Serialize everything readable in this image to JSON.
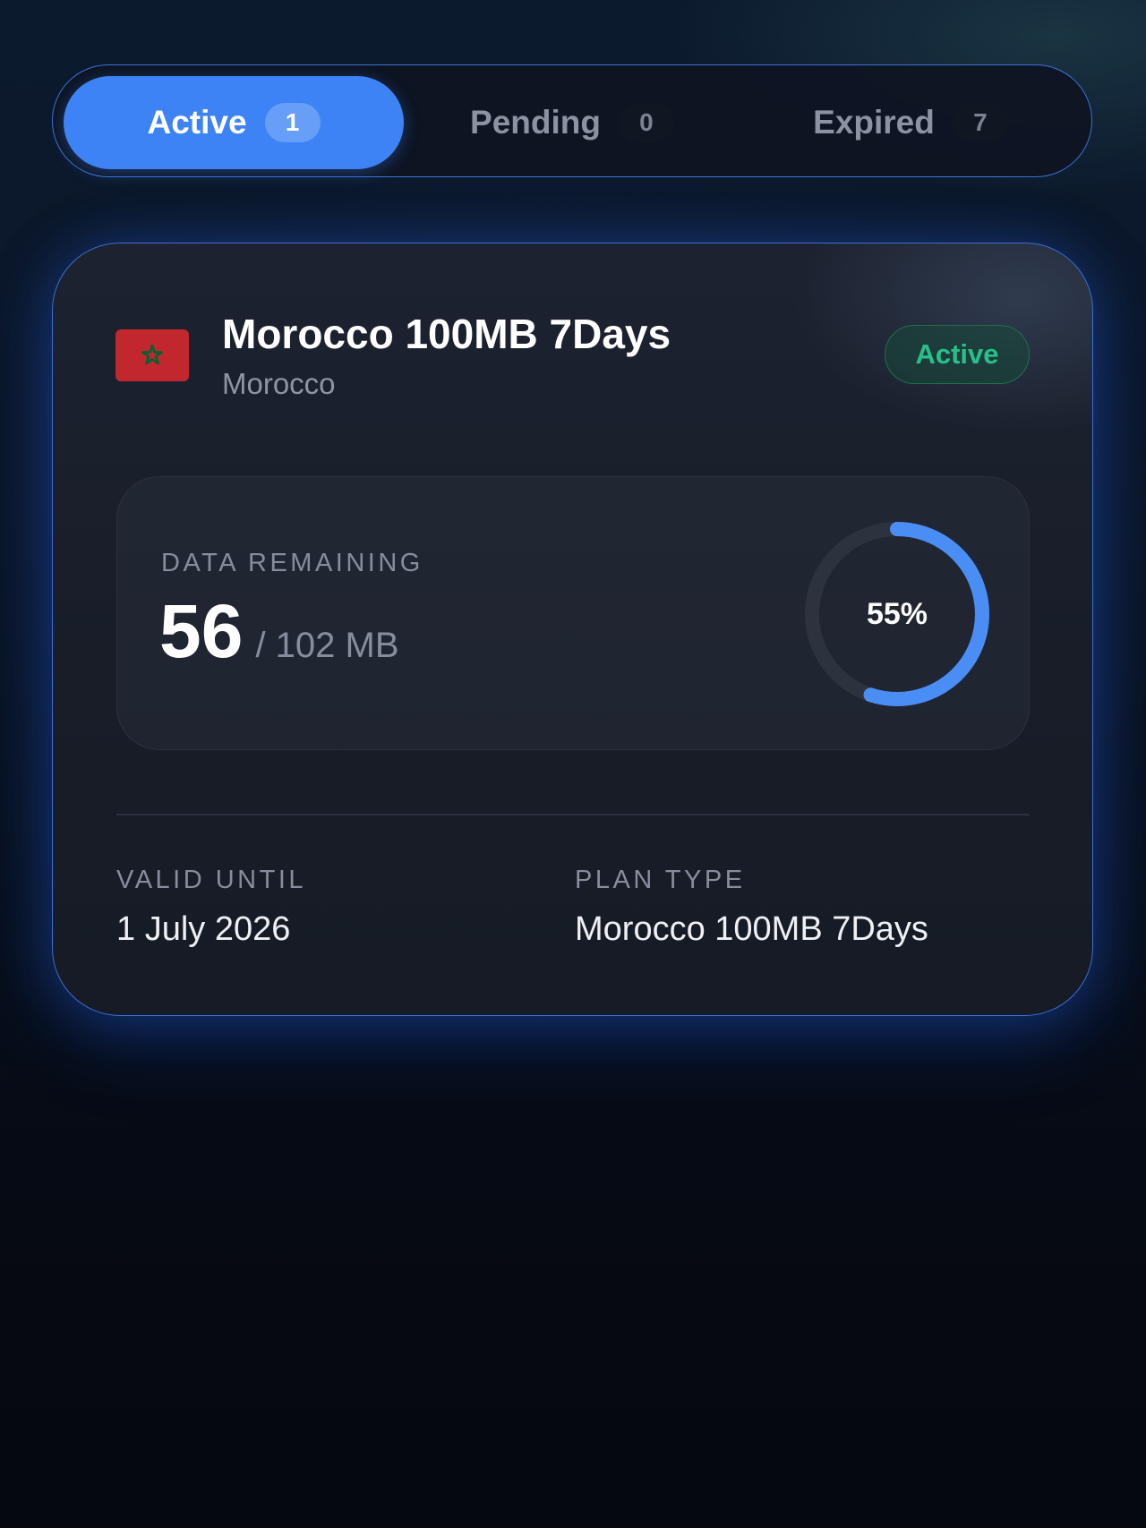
{
  "tabs": [
    {
      "label": "Active",
      "count": "1",
      "selected": true
    },
    {
      "label": "Pending",
      "count": "0",
      "selected": false
    },
    {
      "label": "Expired",
      "count": "7",
      "selected": false
    }
  ],
  "plan": {
    "title": "Morocco 100MB 7Days",
    "country": "Morocco",
    "flag_icon": "morocco-flag-icon",
    "status": "Active",
    "status_color": "#27c08a"
  },
  "usage": {
    "label": "DATA REMAINING",
    "remaining": "56",
    "total": "/ 102 MB",
    "percent_label": "55%",
    "percent_value": 0.55,
    "ring_color": "#4a8ef5"
  },
  "details": {
    "valid_until_label": "VALID UNTIL",
    "valid_until": "1 July 2026",
    "plan_type_label": "PLAN TYPE",
    "plan_type": "Morocco 100MB 7Days"
  },
  "colors": {
    "accent": "#3d83f5",
    "card_border": "#3b6fd4"
  }
}
